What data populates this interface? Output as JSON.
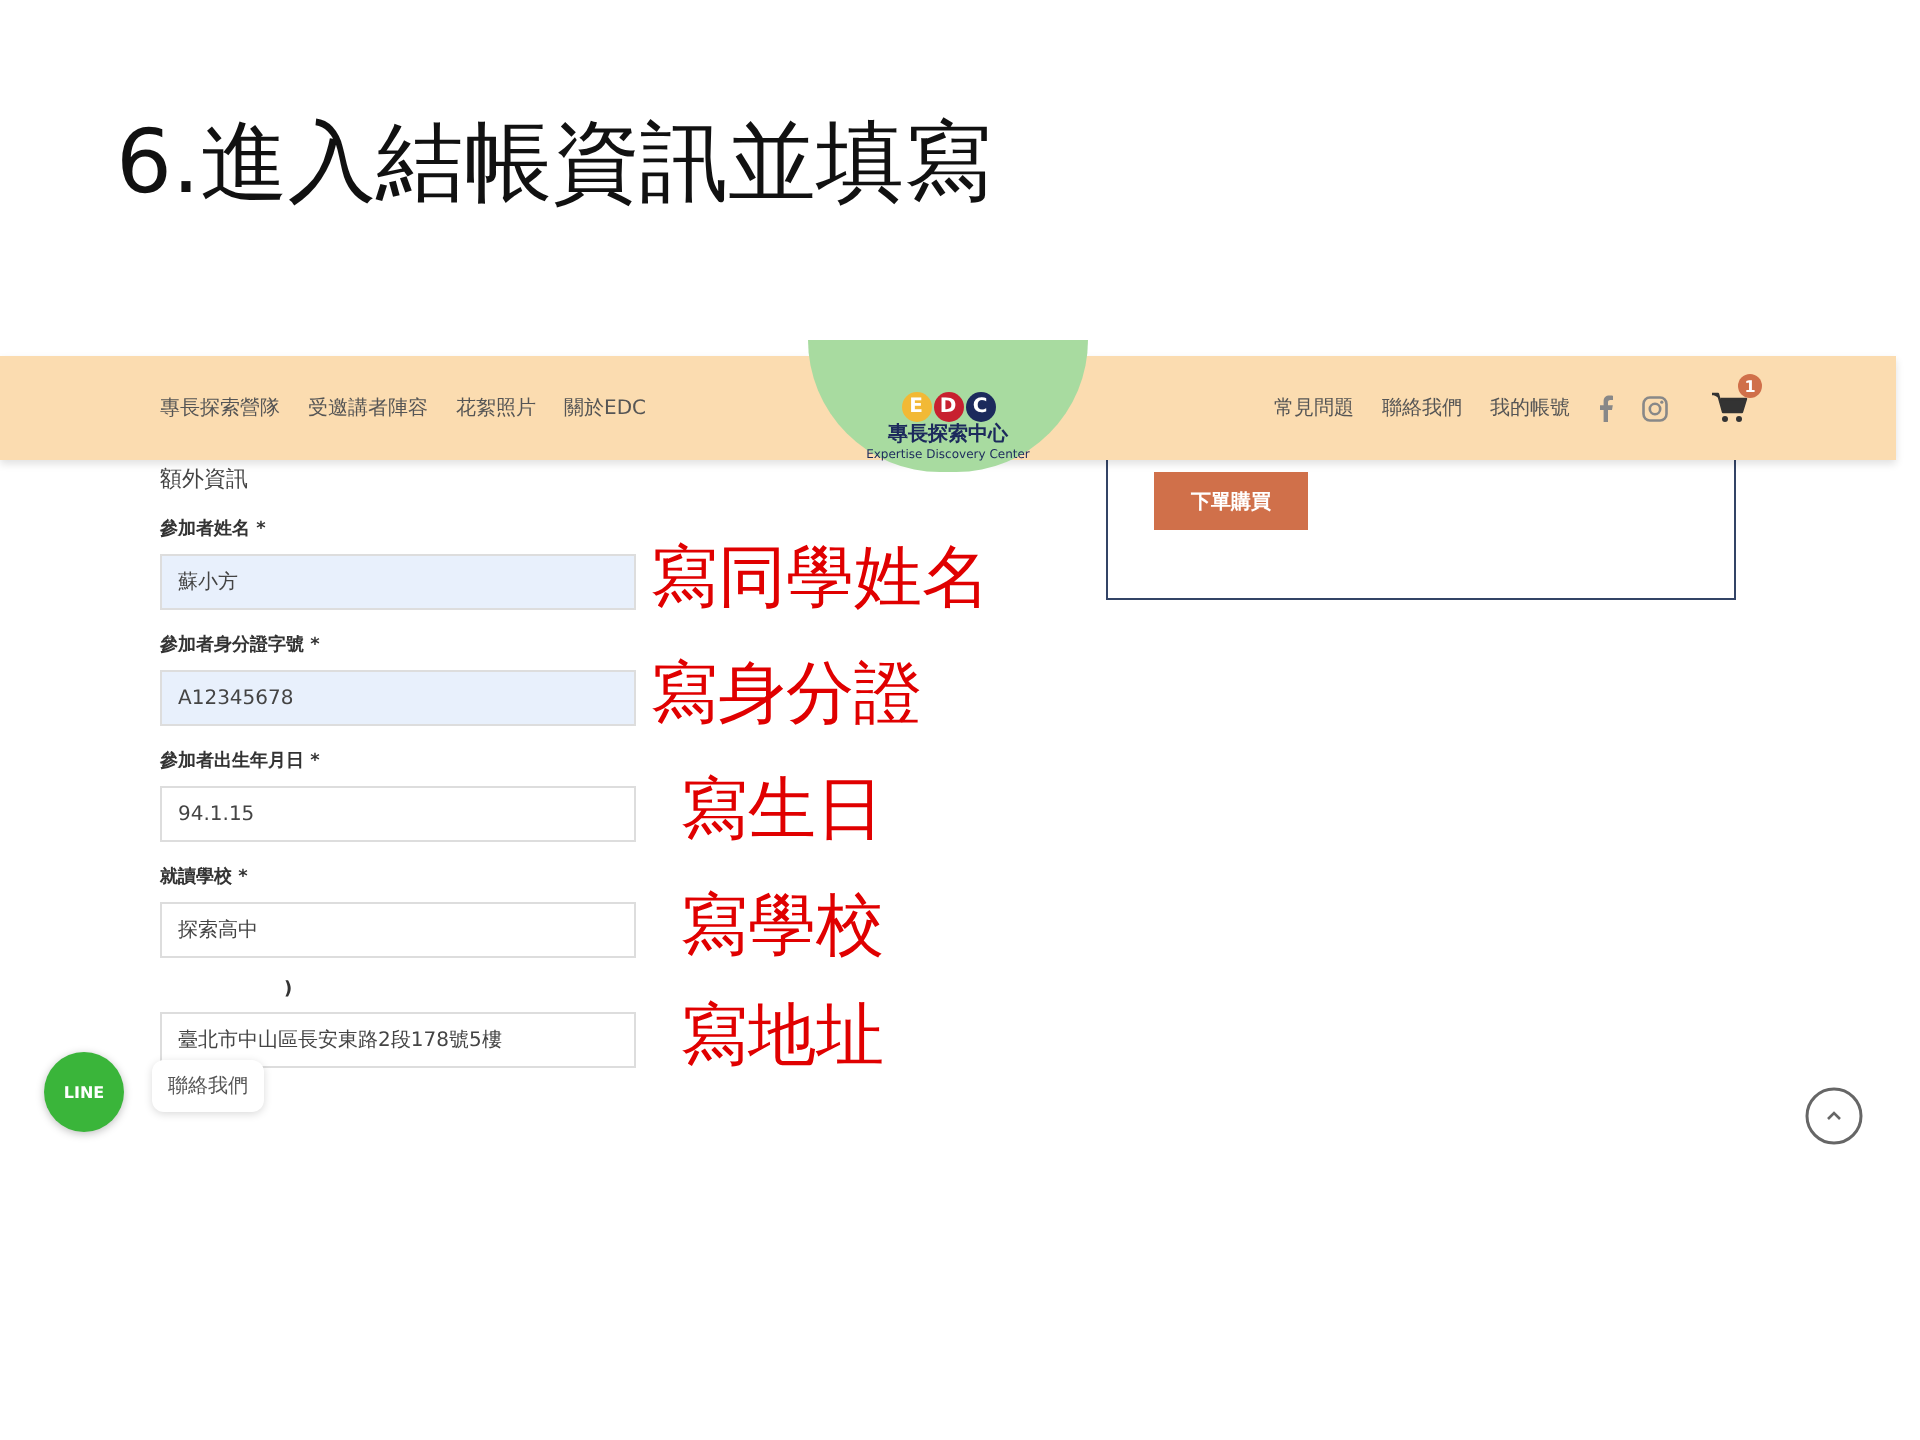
{
  "slide_title": "6.進入結帳資訊並填寫",
  "header": {
    "nav_left": [
      "專長探索營隊",
      "受邀講者陣容",
      "花絮照片",
      "關於EDC"
    ],
    "logo": {
      "letters": [
        {
          "text": "E",
          "color": "#f2b935"
        },
        {
          "text": "D",
          "color": "#c8202f"
        },
        {
          "text": "C",
          "color": "#1c2a5c"
        }
      ],
      "tagline": "專長探索中心",
      "subtitle": "Expertise Discovery Center"
    },
    "nav_right": [
      "常見問題",
      "聯絡我們",
      "我的帳號"
    ],
    "cart": {
      "count": "1"
    }
  },
  "order_button": "下單購買",
  "form": {
    "section_title": "額外資訊",
    "fields": [
      {
        "label": "參加者姓名 *",
        "value": "蘇小方",
        "autofilled": true,
        "annotation": "寫同學姓名"
      },
      {
        "label": "參加者身分證字號 *",
        "value": "A12345678",
        "autofilled": true,
        "annotation": "寫身分證"
      },
      {
        "label": "參加者出生年月日 *",
        "value": "94.1.15",
        "autofilled": false,
        "annotation": "寫生日"
      },
      {
        "label": "就讀學校 *",
        "value": "探索高中",
        "autofilled": false,
        "annotation": "寫學校"
      },
      {
        "label": ")",
        "value": "臺北市中山區長安東路2段178號5樓",
        "autofilled": false,
        "annotation": "寫地址"
      }
    ]
  },
  "chat_widget": {
    "badge": "LINE",
    "label": "聯絡我們"
  }
}
